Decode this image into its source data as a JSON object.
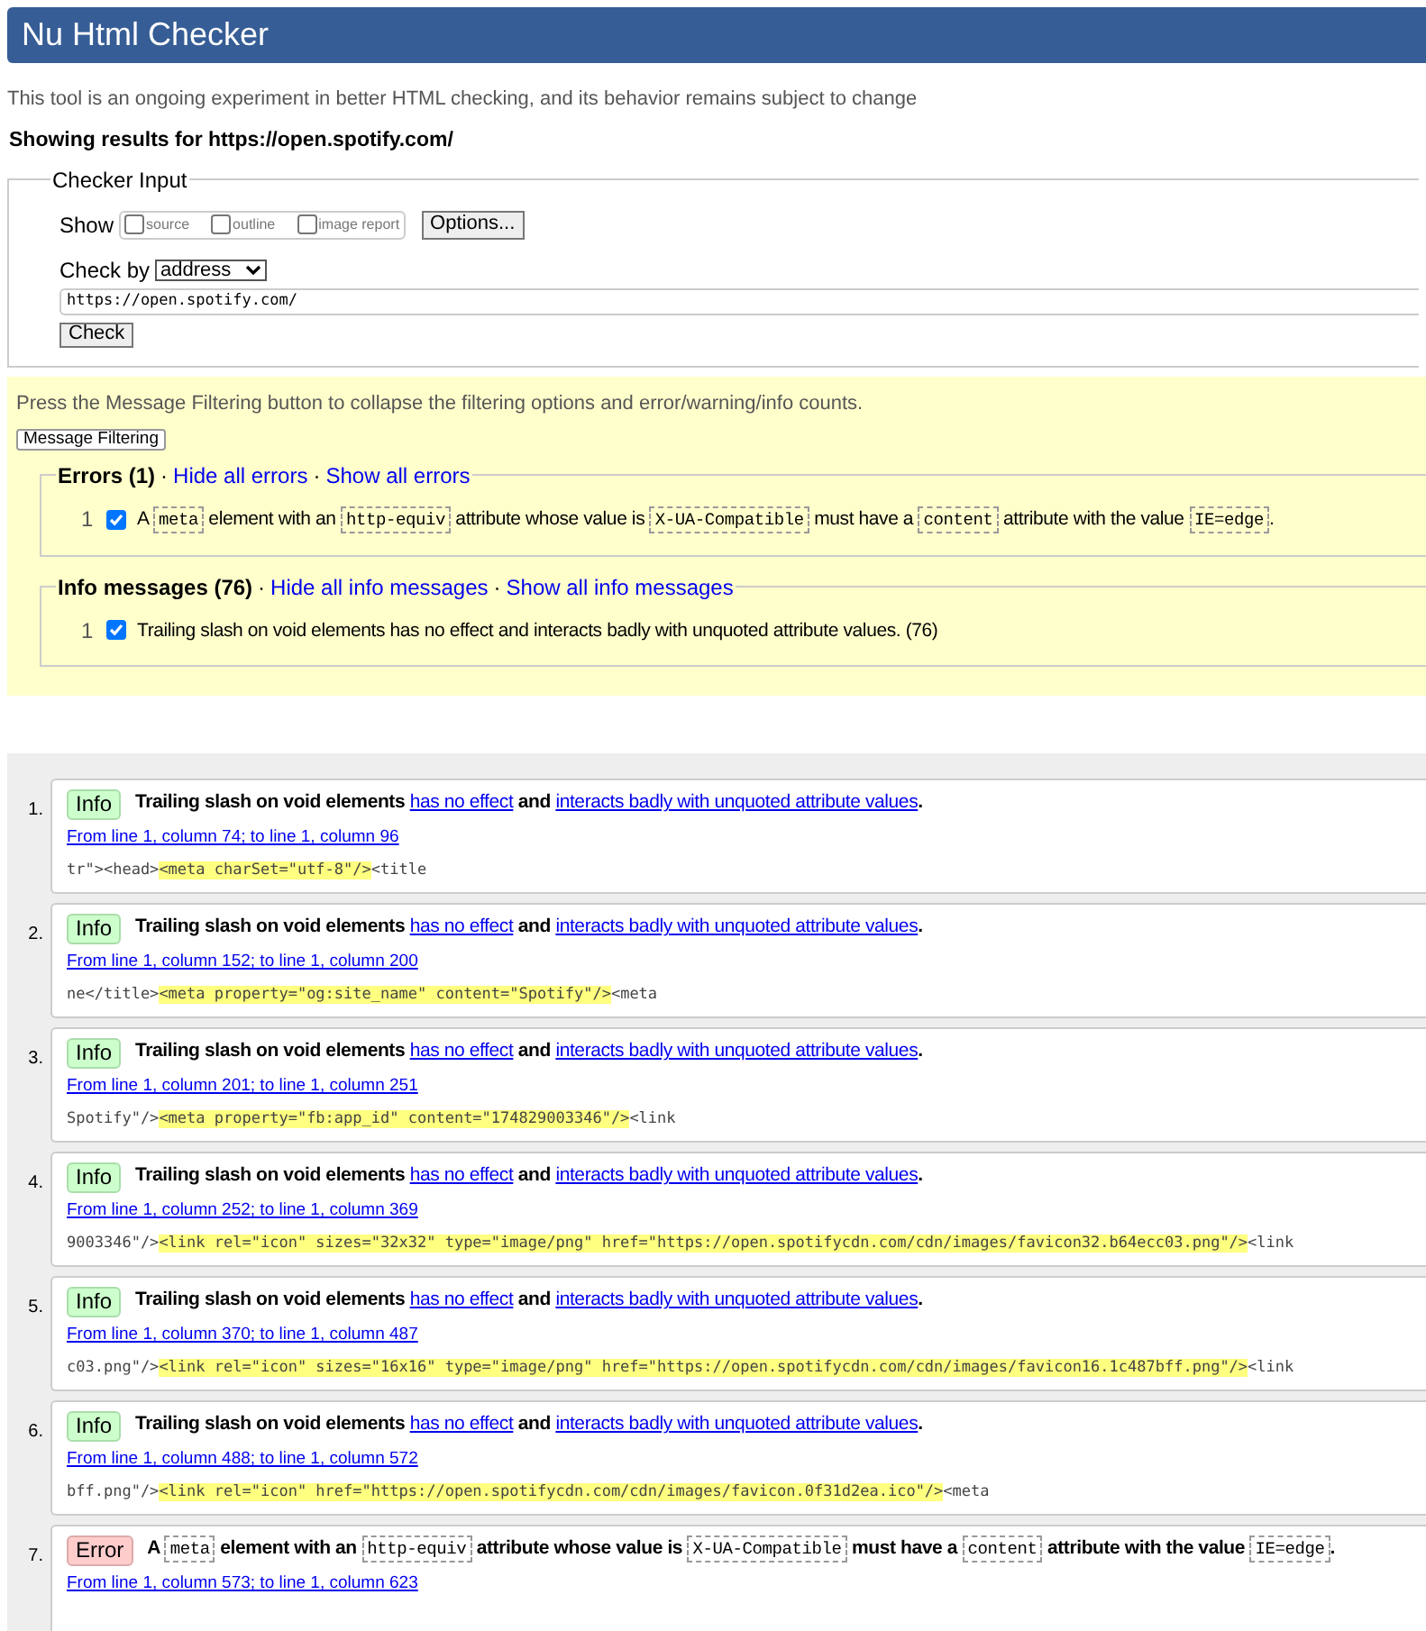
{
  "header": {
    "title": "Nu Html Checker"
  },
  "intro": "This tool is an ongoing experiment in better HTML checking, and its behavior remains subject to change",
  "results_for": "Showing results for https://open.spotify.com/",
  "checker_input": {
    "legend": "Checker Input",
    "show_label": "Show",
    "show_options": [
      {
        "label": "source",
        "checked": false
      },
      {
        "label": "outline",
        "checked": false
      },
      {
        "label": "image report",
        "checked": false
      }
    ],
    "options_button": "Options...",
    "check_by_label": "Check by",
    "check_by_value": "address",
    "url": "https://open.spotify.com/",
    "check_button": "Check"
  },
  "filtering": {
    "note": "Press the Message Filtering button to collapse the filtering options and error/warning/info counts.",
    "button": "Message Filtering",
    "groups": [
      {
        "title": "Errors (1)",
        "separator": "·",
        "hide_link": "Hide all errors",
        "show_link": "Show all errors",
        "rows": [
          {
            "number": "1",
            "checked": true,
            "segments": [
              {
                "kind": "text",
                "text": "A "
              },
              {
                "kind": "code",
                "text": "meta"
              },
              {
                "kind": "text",
                "text": " element with an "
              },
              {
                "kind": "code",
                "text": "http-equiv"
              },
              {
                "kind": "text",
                "text": " attribute whose value is "
              },
              {
                "kind": "code",
                "text": "X-UA-Compatible"
              },
              {
                "kind": "text",
                "text": " must have a "
              },
              {
                "kind": "code",
                "text": "content"
              },
              {
                "kind": "text",
                "text": " attribute with the value "
              },
              {
                "kind": "code",
                "text": "IE=edge"
              },
              {
                "kind": "text",
                "text": "."
              }
            ]
          }
        ]
      },
      {
        "title": "Info messages (76)",
        "separator": "·",
        "hide_link": "Hide all info messages",
        "show_link": "Show all info messages",
        "rows": [
          {
            "number": "1",
            "checked": true,
            "segments": [
              {
                "kind": "text",
                "text": "Trailing slash on void elements has no effect and interacts badly with unquoted attribute values. (76)"
              }
            ]
          }
        ]
      }
    ]
  },
  "messages": [
    {
      "number": "1.",
      "kind": "info",
      "badge": "Info",
      "segments": [
        {
          "kind": "text",
          "text": "Trailing slash on void elements "
        },
        {
          "kind": "link",
          "text": "has no effect"
        },
        {
          "kind": "text",
          "text": " and "
        },
        {
          "kind": "link",
          "text": "interacts badly with unquoted attribute values"
        },
        {
          "kind": "text",
          "text": "."
        }
      ],
      "location": "From line 1, column 74; to line 1, column 96",
      "extract": {
        "before": "tr\"><head>",
        "highlight": "<meta charSet=\"utf-8\"/>",
        "after": "<title"
      }
    },
    {
      "number": "2.",
      "kind": "info",
      "badge": "Info",
      "segments": [
        {
          "kind": "text",
          "text": "Trailing slash on void elements "
        },
        {
          "kind": "link",
          "text": "has no effect"
        },
        {
          "kind": "text",
          "text": " and "
        },
        {
          "kind": "link",
          "text": "interacts badly with unquoted attribute values"
        },
        {
          "kind": "text",
          "text": "."
        }
      ],
      "location": "From line 1, column 152; to line 1, column 200",
      "extract": {
        "before": "ne</title>",
        "highlight": "<meta property=\"og:site_name\" content=\"Spotify\"/>",
        "after": "<meta"
      }
    },
    {
      "number": "3.",
      "kind": "info",
      "badge": "Info",
      "segments": [
        {
          "kind": "text",
          "text": "Trailing slash on void elements "
        },
        {
          "kind": "link",
          "text": "has no effect"
        },
        {
          "kind": "text",
          "text": " and "
        },
        {
          "kind": "link",
          "text": "interacts badly with unquoted attribute values"
        },
        {
          "kind": "text",
          "text": "."
        }
      ],
      "location": "From line 1, column 201; to line 1, column 251",
      "extract": {
        "before": "Spotify\"/>",
        "highlight": "<meta property=\"fb:app_id\" content=\"174829003346\"/>",
        "after": "<link"
      }
    },
    {
      "number": "4.",
      "kind": "info",
      "badge": "Info",
      "segments": [
        {
          "kind": "text",
          "text": "Trailing slash on void elements "
        },
        {
          "kind": "link",
          "text": "has no effect"
        },
        {
          "kind": "text",
          "text": " and "
        },
        {
          "kind": "link",
          "text": "interacts badly with unquoted attribute values"
        },
        {
          "kind": "text",
          "text": "."
        }
      ],
      "location": "From line 1, column 252; to line 1, column 369",
      "extract": {
        "before": "9003346\"/>",
        "highlight": "<link rel=\"icon\" sizes=\"32x32\" type=\"image/png\" href=\"https://open.spotifycdn.com/cdn/images/favicon32.b64ecc03.png\"/>",
        "after": "<link"
      }
    },
    {
      "number": "5.",
      "kind": "info",
      "badge": "Info",
      "segments": [
        {
          "kind": "text",
          "text": "Trailing slash on void elements "
        },
        {
          "kind": "link",
          "text": "has no effect"
        },
        {
          "kind": "text",
          "text": " and "
        },
        {
          "kind": "link",
          "text": "interacts badly with unquoted attribute values"
        },
        {
          "kind": "text",
          "text": "."
        }
      ],
      "location": "From line 1, column 370; to line 1, column 487",
      "extract": {
        "before": "c03.png\"/>",
        "highlight": "<link rel=\"icon\" sizes=\"16x16\" type=\"image/png\" href=\"https://open.spotifycdn.com/cdn/images/favicon16.1c487bff.png\"/>",
        "after": "<link"
      }
    },
    {
      "number": "6.",
      "kind": "info",
      "badge": "Info",
      "segments": [
        {
          "kind": "text",
          "text": "Trailing slash on void elements "
        },
        {
          "kind": "link",
          "text": "has no effect"
        },
        {
          "kind": "text",
          "text": " and "
        },
        {
          "kind": "link",
          "text": "interacts badly with unquoted attribute values"
        },
        {
          "kind": "text",
          "text": "."
        }
      ],
      "location": "From line 1, column 488; to line 1, column 572",
      "extract": {
        "before": "bff.png\"/>",
        "highlight": "<link rel=\"icon\" href=\"https://open.spotifycdn.com/cdn/images/favicon.0f31d2ea.ico\"/>",
        "after": "<meta"
      }
    },
    {
      "number": "7.",
      "kind": "error",
      "badge": "Error",
      "segments": [
        {
          "kind": "text",
          "text": "A "
        },
        {
          "kind": "code",
          "text": "meta"
        },
        {
          "kind": "text",
          "text": " element with an "
        },
        {
          "kind": "code",
          "text": "http-equiv"
        },
        {
          "kind": "text",
          "text": " attribute whose value is "
        },
        {
          "kind": "code",
          "text": "X-UA-Compatible"
        },
        {
          "kind": "text",
          "text": " must have a "
        },
        {
          "kind": "code",
          "text": "content"
        },
        {
          "kind": "text",
          "text": " attribute with the value "
        },
        {
          "kind": "code",
          "text": "IE=edge"
        },
        {
          "kind": "text",
          "text": "."
        }
      ],
      "location": "From line 1, column 573; to line 1, column 623"
    }
  ]
}
